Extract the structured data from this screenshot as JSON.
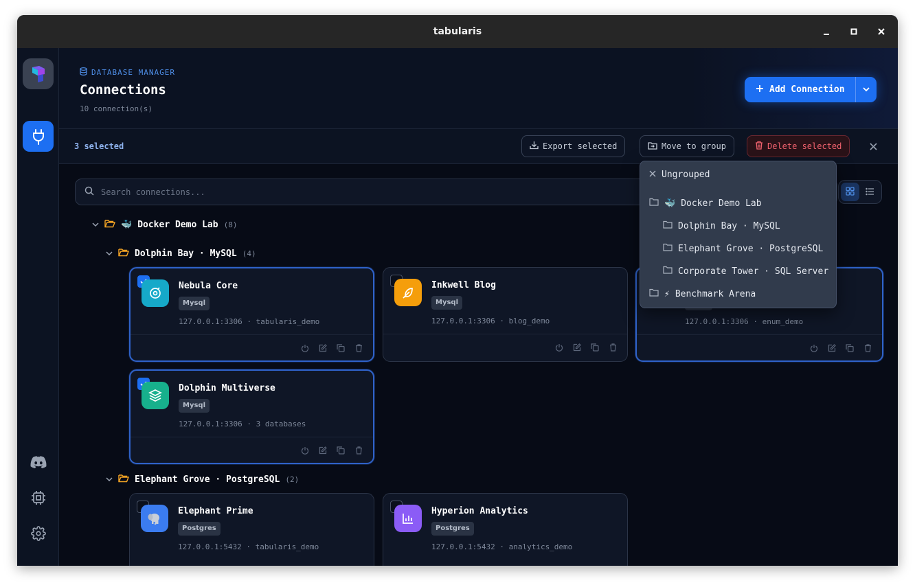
{
  "window": {
    "title": "tabularis"
  },
  "header": {
    "eyebrow": "DATABASE MANAGER",
    "title": "Connections",
    "count": "10 connection(s)",
    "add_label": "Add Connection"
  },
  "selection": {
    "count": "3 selected",
    "export_label": "Export selected",
    "move_label": "Move to group",
    "delete_label": "Delete selected"
  },
  "search": {
    "placeholder": "Search connections..."
  },
  "groups": {
    "docker": {
      "name": "Docker Demo Lab",
      "emoji": "🐳",
      "count": "(8)"
    },
    "dolphin": {
      "name": "Dolphin Bay · MySQL",
      "count": "(4)"
    },
    "elephant": {
      "name": "Elephant Grove · PostgreSQL",
      "count": "(2)"
    }
  },
  "cards": [
    {
      "name": "Nebula Core",
      "badge": "Mysql",
      "host": "127.0.0.1:3306 · tabularis_demo",
      "selected": true,
      "color": "#16a9c9"
    },
    {
      "name": "Inkwell Blog",
      "badge": "Mysql",
      "host": "127.0.0.1:3306 · blog_demo",
      "selected": false,
      "color": "#f59e0b"
    },
    {
      "name": "",
      "badge": "",
      "host": "127.0.0.1:3306 · enum_demo",
      "selected": true,
      "color": "#1d6ff2"
    },
    {
      "name": "Dolphin Multiverse",
      "badge": "Mysql",
      "host": "127.0.0.1:3306 · 3 databases",
      "selected": true,
      "color": "#17b08c"
    },
    {
      "name": "Elephant Prime",
      "badge": "Postgres",
      "host": "127.0.0.1:5432 · tabularis_demo",
      "selected": false,
      "color": "#3b7cf0"
    },
    {
      "name": "Hyperion Analytics",
      "badge": "Postgres",
      "host": "127.0.0.1:5432 · analytics_demo",
      "selected": false,
      "color": "#8b5cf6"
    }
  ],
  "dropdown": {
    "ungrouped": "Ungrouped",
    "docker": "Docker Demo Lab",
    "docker_emoji": "🐳",
    "dolphin": "Dolphin Bay · MySQL",
    "elephant": "Elephant Grove · PostgreSQL",
    "corporate": "Corporate Tower · SQL Server",
    "benchmark": "Benchmark Arena",
    "benchmark_emoji": "⚡"
  }
}
